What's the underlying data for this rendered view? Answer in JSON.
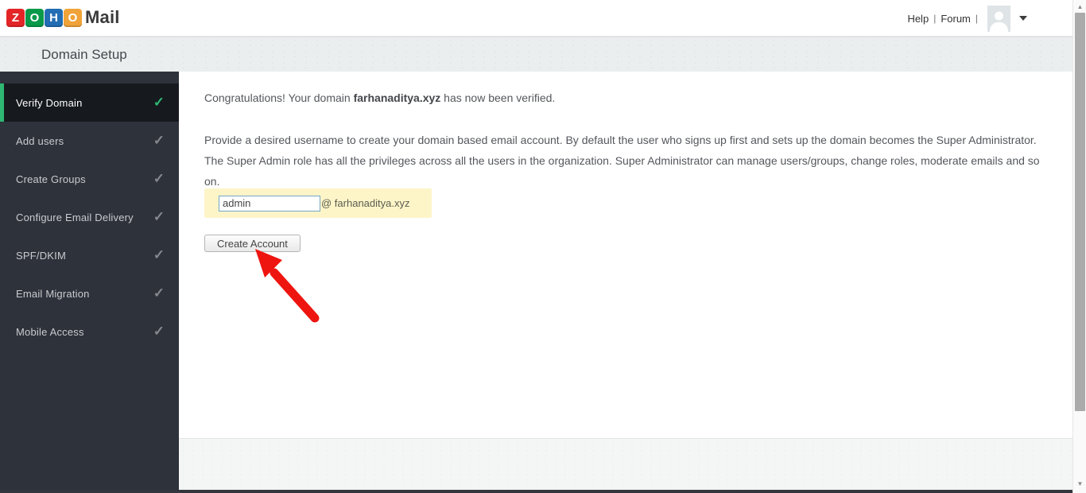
{
  "header": {
    "logo": {
      "tiles": [
        {
          "letter": "Z",
          "color": "#e42527"
        },
        {
          "letter": "O",
          "color": "#089949"
        },
        {
          "letter": "H",
          "color": "#226db4"
        },
        {
          "letter": "O",
          "color": "#f0a338"
        }
      ],
      "product": "Mail"
    },
    "links": {
      "help": "Help",
      "forum": "Forum"
    },
    "separator": "|"
  },
  "page_title": "Domain Setup",
  "sidebar": {
    "items": [
      {
        "label": "Verify Domain",
        "active": true,
        "completed": true
      },
      {
        "label": "Add users",
        "active": false,
        "completed": true
      },
      {
        "label": "Create Groups",
        "active": false,
        "completed": true
      },
      {
        "label": "Configure Email Delivery",
        "active": false,
        "completed": true
      },
      {
        "label": "SPF/DKIM",
        "active": false,
        "completed": true
      },
      {
        "label": "Email Migration",
        "active": false,
        "completed": true
      },
      {
        "label": "Mobile Access",
        "active": false,
        "completed": true
      }
    ]
  },
  "main": {
    "congrats_prefix": "Congratulations! Your domain ",
    "domain": "farhanaditya.xyz",
    "congrats_suffix": " has now been verified.",
    "description": "Provide a desired username to create your domain based email account. By default the user who signs up first and sets up the domain becomes the Super Administrator. The Super Admin role has all the privileges across all the users in the organization. Super Administrator can manage users/groups, change roles, moderate emails and so on.",
    "username_value": "admin",
    "domain_suffix": "@ farhanaditya.xyz",
    "create_button_label": "Create Account"
  },
  "icons": {
    "check": "✓",
    "scroll_up": "▲",
    "scroll_down": "▼"
  },
  "colors": {
    "sidebar_bg": "#2e323b",
    "sidebar_active_bg": "#16191e",
    "active_green": "#2eb873",
    "highlight_yellow": "#fdf5c8",
    "annotation_arrow_red": "#ee1510",
    "titlebar_bg": "#ebeeee"
  }
}
